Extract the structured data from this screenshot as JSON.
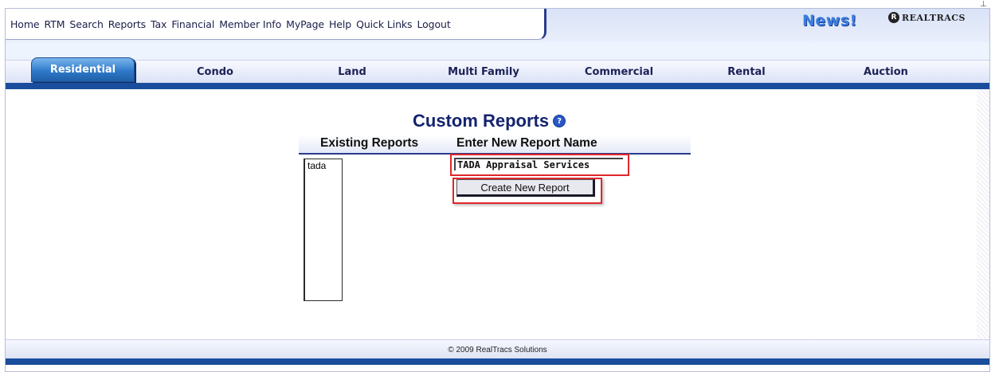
{
  "window": {
    "scroll_glyph": "⊥"
  },
  "menu": {
    "items": [
      "Home",
      "RTM",
      "Search",
      "Reports",
      "Tax",
      "Financial",
      "Member Info",
      "MyPage",
      "Help",
      "Quick Links",
      "Logout"
    ]
  },
  "header": {
    "news_label": "News!",
    "logo_text": "REALTRACS",
    "logo_mark": "R"
  },
  "tabs": [
    {
      "label": "Residential",
      "active": true
    },
    {
      "label": "Condo",
      "active": false
    },
    {
      "label": "Land",
      "active": false
    },
    {
      "label": "Multi Family",
      "active": false
    },
    {
      "label": "Commercial",
      "active": false
    },
    {
      "label": "Rental",
      "active": false
    },
    {
      "label": "Auction",
      "active": false
    }
  ],
  "main": {
    "title": "Custom Reports",
    "help_glyph": "?",
    "existing_reports_header": "Existing Reports",
    "new_report_header": "Enter New Report Name",
    "existing_reports": [
      "tada"
    ],
    "new_report_name_value": "TADA Appraisal Services",
    "create_button_label": "Create New Report"
  },
  "footer": {
    "copyright": "© 2009 RealTracs Solutions"
  },
  "colors": {
    "nav_blue": "#1a4d9c",
    "title_navy": "#14236e",
    "highlight_red": "#e0262b",
    "news_blue": "#3a7fe0"
  }
}
